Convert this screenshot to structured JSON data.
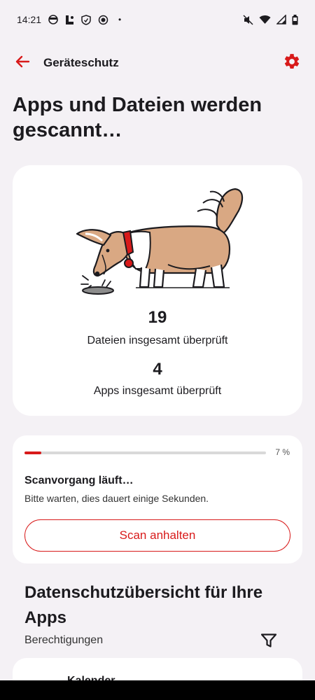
{
  "status_bar": {
    "time": "14:21",
    "left_icons": [
      "android-face-icon",
      "app-notification-icon",
      "shield-notification-icon",
      "record-icon"
    ],
    "dot": "•",
    "right_icons": [
      "mute-icon",
      "wifi-icon",
      "signal-icon",
      "battery-icon"
    ]
  },
  "app_bar": {
    "title": "Geräteschutz",
    "back_icon": "arrow-left-icon",
    "settings_icon": "gear-icon"
  },
  "page": {
    "title": "Apps und Dateien werden gescannt…"
  },
  "scan_card": {
    "illustration": "dog-sniffing-illustration",
    "files_count": "19",
    "files_label": "Dateien insgesamt überprüft",
    "apps_count": "4",
    "apps_label": "Apps insgesamt überprüft"
  },
  "progress_card": {
    "progress": 0.07,
    "percent_label": "7 %",
    "status": "Scanvorgang läuft…",
    "sub": "Bitte warten, dies dauert einige Sekunden.",
    "stop_button": "Scan anhalten"
  },
  "privacy": {
    "title": "Datenschutzübersicht für Ihre Apps",
    "permissions_label": "Berechtigungen",
    "filter_icon": "filter-icon",
    "first_item": "Kalender"
  },
  "colors": {
    "accent": "#d81a1a",
    "background": "#f4f1f5",
    "card": "#ffffff"
  }
}
